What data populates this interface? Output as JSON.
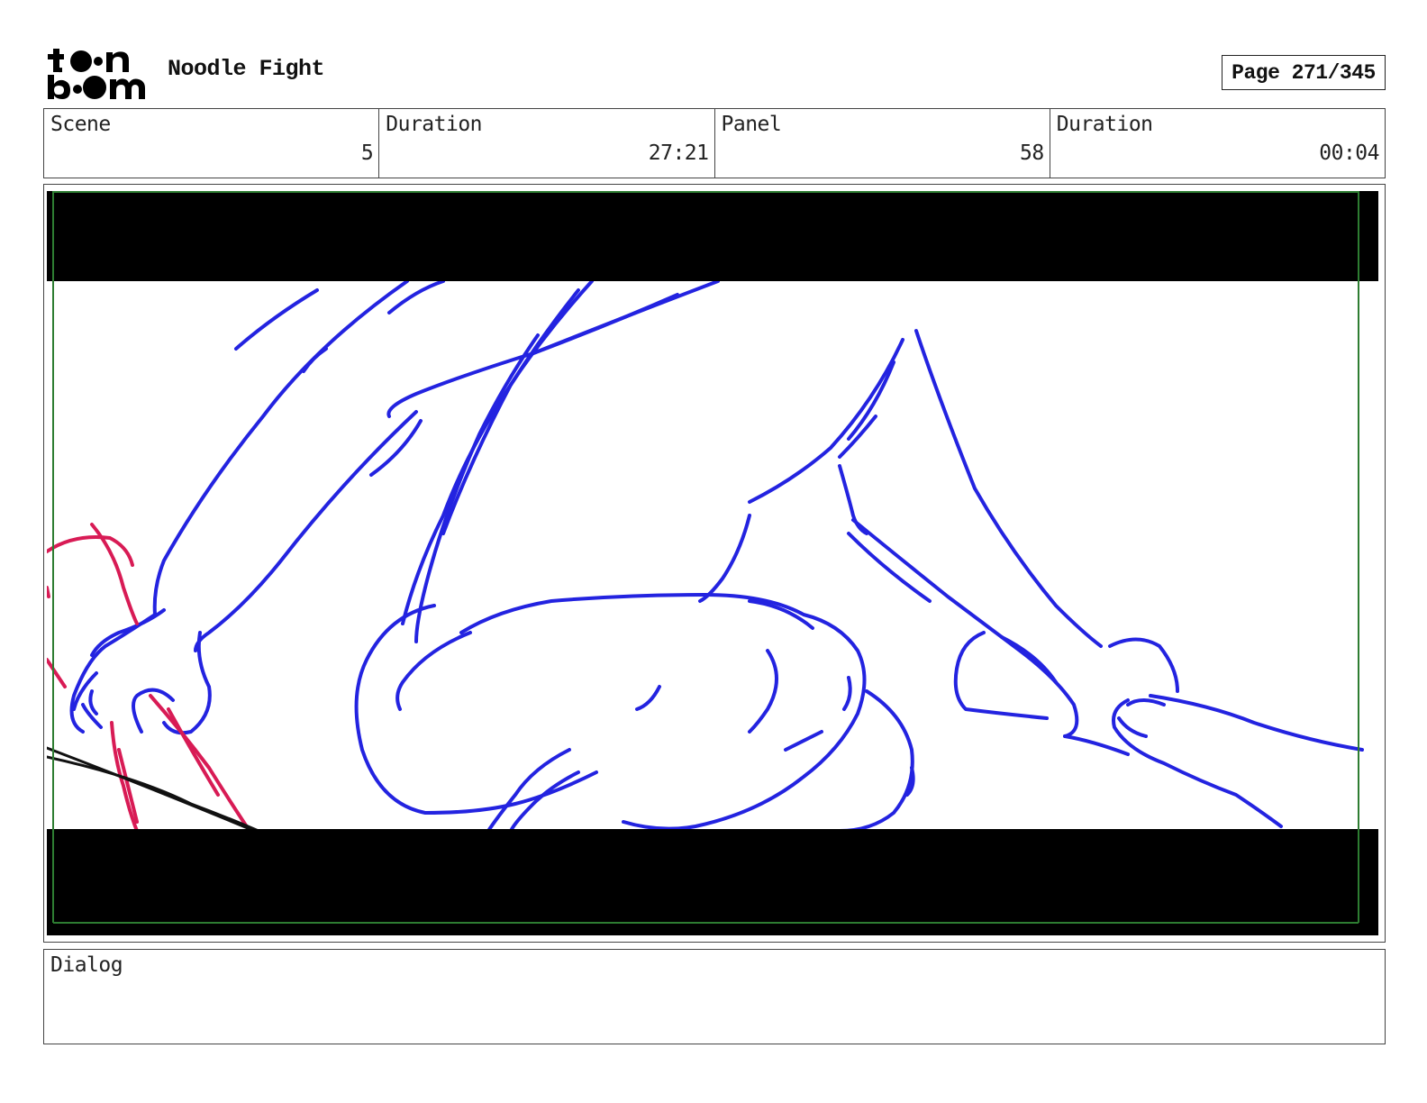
{
  "header": {
    "logo_text": "toon boom",
    "project_title": "Noodle Fight",
    "page_indicator": "Page 271/345"
  },
  "info": {
    "scene_label": "Scene",
    "scene_value": "5",
    "scene_duration_label": "Duration",
    "scene_duration_value": "27:21",
    "panel_label": "Panel",
    "panel_value": "58",
    "panel_duration_label": "Duration",
    "panel_duration_value": "00:04"
  },
  "panel": {
    "letterbox_color": "#000000",
    "safe_frame_color": "#2e7d32",
    "sketch_colors": {
      "blue": "#2323e0",
      "red": "#d81b55",
      "black": "#111111"
    }
  },
  "dialog": {
    "label": "Dialog",
    "text": ""
  }
}
